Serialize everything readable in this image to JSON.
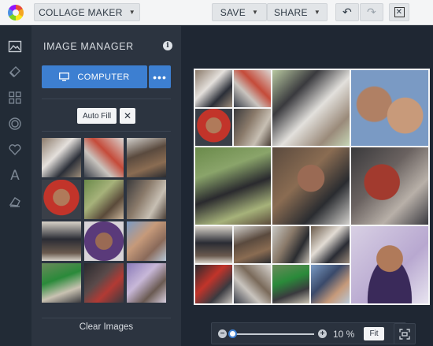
{
  "header": {
    "app_title": "COLLAGE MAKER",
    "save_label": "SAVE",
    "share_label": "SHARE",
    "icons": {
      "undo": "undo-icon",
      "redo": "redo-icon",
      "close": "close-icon",
      "caret": "caret-down-icon"
    }
  },
  "rail": {
    "items": [
      "layout-icon",
      "background-icon",
      "grid-icon",
      "shape-icon",
      "heart-icon",
      "text-icon",
      "eraser-icon"
    ],
    "text_glyph": "A"
  },
  "panel": {
    "title": "IMAGE MANAGER",
    "computer_label": "COMPUTER",
    "more_label": "•••",
    "auto_fill_label": "Auto Fill",
    "clear_x": "✕",
    "clear_images_label": "Clear Images",
    "thumbnail_count": 12
  },
  "zoom": {
    "value_label": "10 %",
    "fit_label": "Fit",
    "level": 0.04
  },
  "colors": {
    "accent": "#3d7fd1",
    "dark_bg": "#1f2733",
    "panel_bg": "#2c3440",
    "topbar_bg": "#f4f5f6"
  }
}
